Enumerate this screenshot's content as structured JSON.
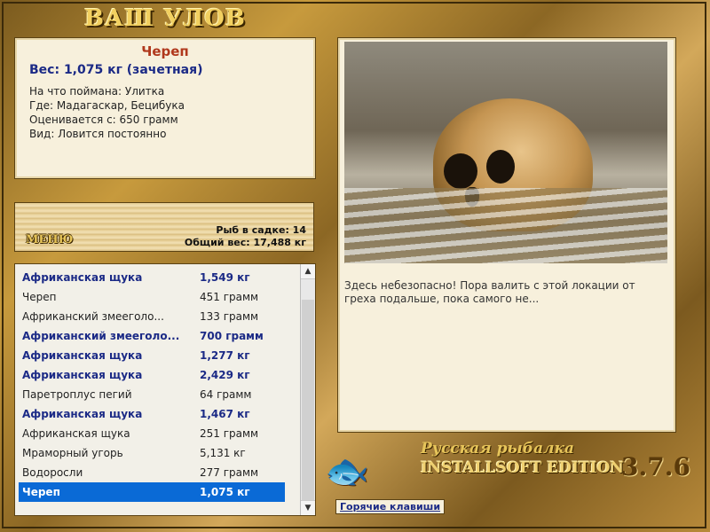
{
  "window": {
    "title": "ВАШ УЛОВ"
  },
  "info": {
    "name": "Череп",
    "weight": "Вес: 1,075 кг (зачетная)",
    "bait": "На что поймана: Улитка",
    "location": "Где: Мадагаскар, Бецибука",
    "value": "Оценивается с: 650 грамм",
    "kind": "Вид: Ловится постоянно"
  },
  "menu": {
    "label": "МЕНЮ",
    "fish_count": "Рыб в садке: 14",
    "total_weight": "Общий вес: 17,488 кг"
  },
  "catch_list": {
    "rows": [
      {
        "name": "Африканская щука",
        "weight": "1,549 кг",
        "bold": true
      },
      {
        "name": "Череп",
        "weight": "451 грамм",
        "bold": false
      },
      {
        "name": "Африканский змееголо...",
        "weight": "133 грамм",
        "bold": false
      },
      {
        "name": "Африканский змееголо...",
        "weight": "700 грамм",
        "bold": true
      },
      {
        "name": "Африканская щука",
        "weight": "1,277 кг",
        "bold": true
      },
      {
        "name": "Африканская щука",
        "weight": "2,429 кг",
        "bold": true
      },
      {
        "name": "Паретроплус пегий",
        "weight": "64 грамм",
        "bold": false
      },
      {
        "name": "Африканская щука",
        "weight": "1,467 кг",
        "bold": true
      },
      {
        "name": "Африканская щука",
        "weight": "251 грамм",
        "bold": false
      },
      {
        "name": "Мраморный угорь",
        "weight": "5,131 кг",
        "bold": false
      },
      {
        "name": "Водоросли",
        "weight": "277 грамм",
        "bold": false
      },
      {
        "name": "Череп",
        "weight": "1,075 кг",
        "bold": true,
        "selected": true
      }
    ]
  },
  "picture": {
    "description": "Здесь небезопасно! Пора валить с этой локации от греха подальше, пока самого не..."
  },
  "brand": {
    "line1": "Русская рыбалка",
    "line2": "INSTALLSOFT EDITION",
    "version": "3.7.6"
  },
  "hotkeys": {
    "label": "Горячие клавиши"
  },
  "colors": {
    "accent": "#1b2a86",
    "selected": "#0a6ad6",
    "title": "#b0381c"
  }
}
